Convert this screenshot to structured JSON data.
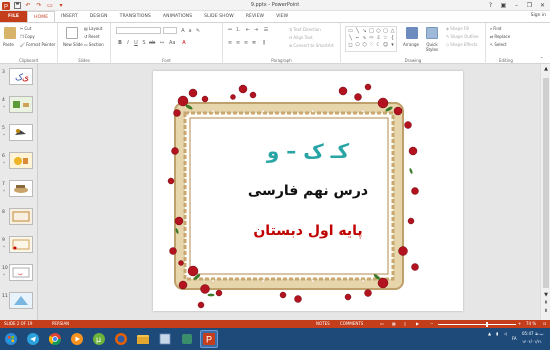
{
  "window": {
    "title": "9.pptx - PowerPoint",
    "sign_in": "Sign in"
  },
  "tabs": [
    "FILE",
    "HOME",
    "INSERT",
    "DESIGN",
    "TRANSITIONS",
    "ANIMATIONS",
    "SLIDE SHOW",
    "REVIEW",
    "VIEW"
  ],
  "ribbon": {
    "clipboard": {
      "label": "Clipboard",
      "paste": "Paste",
      "cut": "Cut",
      "copy": "Copy",
      "format_painter": "Format Painter"
    },
    "slides": {
      "label": "Slides",
      "new_slide": "New Slide",
      "layout": "Layout",
      "reset": "Reset",
      "section": "Section"
    },
    "font": {
      "label": "Font"
    },
    "paragraph": {
      "label": "Paragraph",
      "text_direction": "Text Direction",
      "align_text": "Align Text",
      "convert_smartart": "Convert to SmartArt"
    },
    "drawing": {
      "label": "Drawing",
      "arrange": "Arrange",
      "quick_styles": "Quick Styles",
      "shape_fill": "Shape Fill",
      "shape_outline": "Shape Outline",
      "shape_effects": "Shape Effects"
    },
    "editing": {
      "label": "Editing",
      "find": "Find",
      "replace": "Replace",
      "select": "Select"
    }
  },
  "thumbnails": [
    {
      "num": "3",
      "star": ""
    },
    {
      "num": "4",
      "star": "*"
    },
    {
      "num": "5",
      "star": "*"
    },
    {
      "num": "6",
      "star": "*"
    },
    {
      "num": "7",
      "star": "*"
    },
    {
      "num": "8",
      "star": ""
    },
    {
      "num": "9",
      "star": "*"
    },
    {
      "num": "10",
      "star": "*"
    },
    {
      "num": "11",
      "star": ""
    }
  ],
  "slide": {
    "title": "کـ ک – و",
    "subtitle": "درس نهم فارسی",
    "caption": "پایه اول دبستان"
  },
  "status": {
    "slide_info": "SLIDE 2 OF 19",
    "language": "PERSIAN",
    "notes": "NOTES",
    "comments": "COMMENTS",
    "zoom": "74 %"
  },
  "tray": {
    "lang": "FA",
    "time": "05:47 ب.ظ",
    "date": "۱۴۰۲/۰۱/۲۱"
  },
  "colors": {
    "accent": "#c43e1c",
    "title": "#2aa5a5",
    "subtitle": "#111111",
    "caption": "#c00000"
  }
}
